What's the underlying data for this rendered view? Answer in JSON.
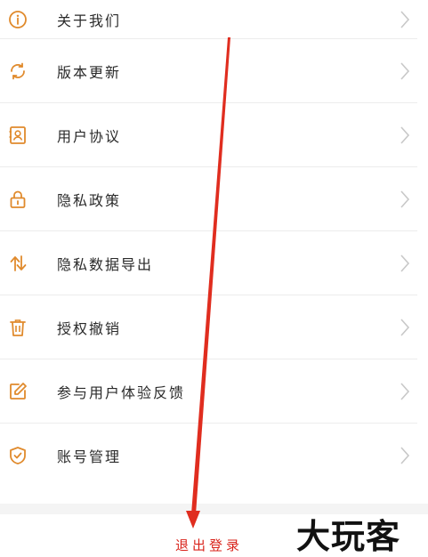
{
  "menu": {
    "items": [
      {
        "label": "关于我们",
        "icon": "info-icon"
      },
      {
        "label": "版本更新",
        "icon": "refresh-icon"
      },
      {
        "label": "用户协议",
        "icon": "contact-card-icon"
      },
      {
        "label": "隐私政策",
        "icon": "lock-icon"
      },
      {
        "label": "隐私数据导出",
        "icon": "swap-arrows-icon"
      },
      {
        "label": "授权撤销",
        "icon": "trash-icon"
      },
      {
        "label": "参与用户体验反馈",
        "icon": "edit-icon"
      },
      {
        "label": "账号管理",
        "icon": "shield-check-icon"
      }
    ]
  },
  "logout": {
    "label": "退出登录"
  },
  "watermark": {
    "text": "大玩客"
  },
  "colors": {
    "accent": "#e08a2c",
    "logout": "#d9241c",
    "annotation_arrow": "#e02d1f",
    "chevron": "#c8c8c8",
    "divider": "#ececec"
  }
}
